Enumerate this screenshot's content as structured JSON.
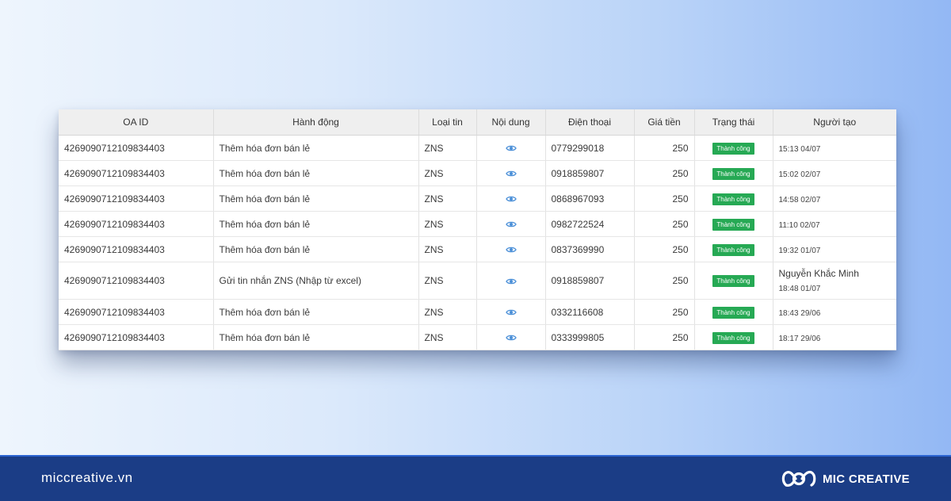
{
  "table": {
    "headers": [
      "OA ID",
      "Hành động",
      "Loại tin",
      "Nội dung",
      "Điện thoại",
      "Giá tiền",
      "Trạng thái",
      "Người tạo"
    ],
    "rows": [
      {
        "oa_id": "4269090712109834403",
        "action": "Thêm hóa đơn bán lẻ",
        "type": "ZNS",
        "content_icon": "eye-icon",
        "phone": "0779299018",
        "price": "250",
        "status": "Thành công",
        "creator_name": "",
        "creator_time": "15:13 04/07"
      },
      {
        "oa_id": "4269090712109834403",
        "action": "Thêm hóa đơn bán lẻ",
        "type": "ZNS",
        "content_icon": "eye-icon",
        "phone": "0918859807",
        "price": "250",
        "status": "Thành công",
        "creator_name": "",
        "creator_time": "15:02 02/07"
      },
      {
        "oa_id": "4269090712109834403",
        "action": "Thêm hóa đơn bán lẻ",
        "type": "ZNS",
        "content_icon": "eye-icon",
        "phone": "0868967093",
        "price": "250",
        "status": "Thành công",
        "creator_name": "",
        "creator_time": "14:58 02/07"
      },
      {
        "oa_id": "4269090712109834403",
        "action": "Thêm hóa đơn bán lẻ",
        "type": "ZNS",
        "content_icon": "eye-icon",
        "phone": "0982722524",
        "price": "250",
        "status": "Thành công",
        "creator_name": "",
        "creator_time": "11:10 02/07"
      },
      {
        "oa_id": "4269090712109834403",
        "action": "Thêm hóa đơn bán lẻ",
        "type": "ZNS",
        "content_icon": "eye-icon",
        "phone": "0837369990",
        "price": "250",
        "status": "Thành công",
        "creator_name": "",
        "creator_time": "19:32 01/07"
      },
      {
        "oa_id": "4269090712109834403",
        "action": "Gửi tin nhắn ZNS (Nhập từ excel)",
        "type": "ZNS",
        "content_icon": "eye-icon",
        "phone": "0918859807",
        "price": "250",
        "status": "Thành công",
        "creator_name": "Nguyễn Khắc Minh",
        "creator_time": "18:48 01/07"
      },
      {
        "oa_id": "4269090712109834403",
        "action": "Thêm hóa đơn bán lẻ",
        "type": "ZNS",
        "content_icon": "eye-icon",
        "phone": "0332116608",
        "price": "250",
        "status": "Thành công",
        "creator_name": "",
        "creator_time": "18:43 29/06"
      },
      {
        "oa_id": "4269090712109834403",
        "action": "Thêm hóa đơn bán lẻ",
        "type": "ZNS",
        "content_icon": "eye-icon",
        "phone": "0333999805",
        "price": "250",
        "status": "Thành công",
        "creator_name": "",
        "creator_time": "18:17 29/06"
      }
    ]
  },
  "footer": {
    "domain": "miccreative.vn",
    "brand": "MIC CREATIVE"
  },
  "colors": {
    "status_badge": "#26a954",
    "eye_icon": "#4a8fd8",
    "footer_bg": "#1b3d86"
  }
}
